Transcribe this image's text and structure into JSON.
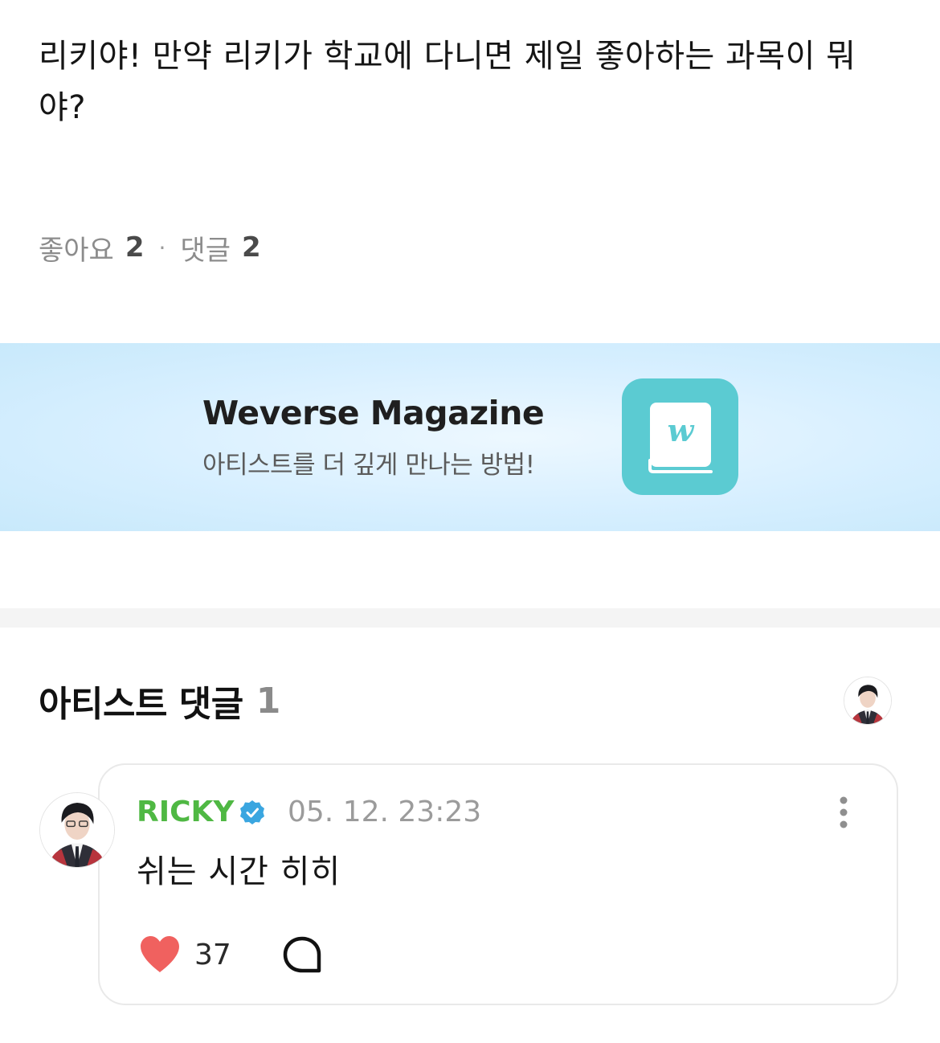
{
  "post": {
    "text": "리키야! 만약 리키가 학교에 다니면 제일 좋아하는 과목이 뭐야?"
  },
  "stats": {
    "likes_label": "좋아요",
    "likes_count": "2",
    "separator": "·",
    "comments_label": "댓글",
    "comments_count": "2"
  },
  "banner": {
    "title": "Weverse Magazine",
    "subtitle": "아티스트를 더 깊게 만나는 방법!",
    "icon": "weverse-magazine-book-icon",
    "icon_letter": "w",
    "icon_color": "#5bcbd2"
  },
  "artist_comments": {
    "title": "아티스트 댓글",
    "count": "1"
  },
  "comment": {
    "author": "RICKY",
    "author_color": "#4fb843",
    "verified_color": "#3aa6e0",
    "timestamp": "05. 12. 23:23",
    "text": "쉬는 시간 히히",
    "like_count": "37",
    "like_color": "#f0615f",
    "icons": [
      "verified-badge-icon",
      "more-vertical-icon",
      "heart-icon",
      "reply-bubble-icon"
    ]
  }
}
